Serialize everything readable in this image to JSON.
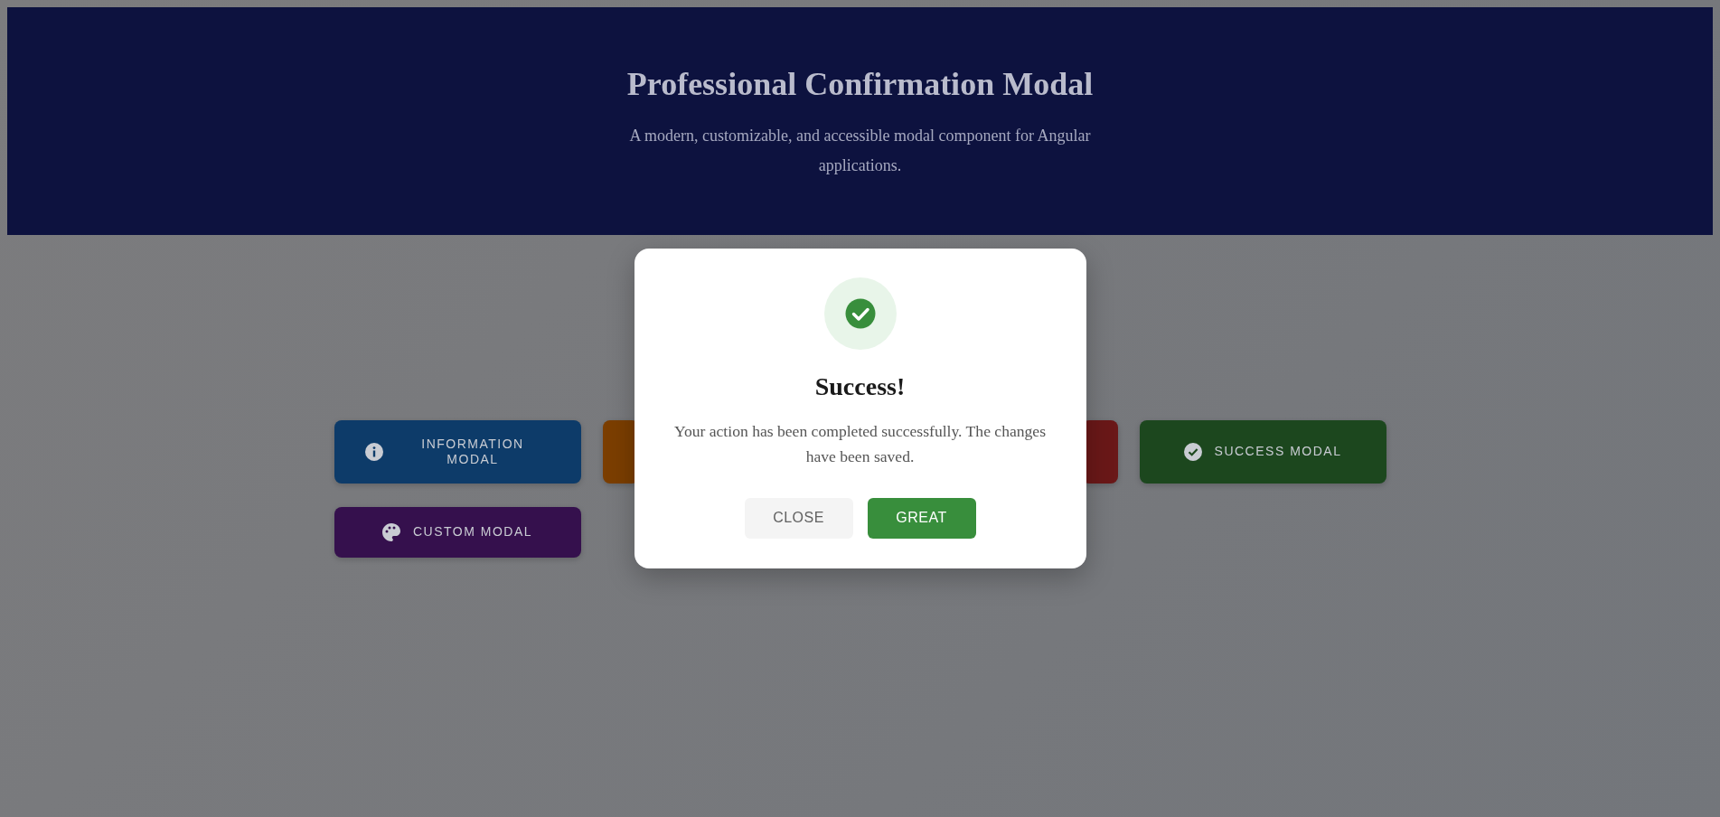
{
  "page": {
    "header": {
      "title": "Professional Confirmation Modal",
      "subtitle": "A modern, customizable, and accessible modal component for Angular applications."
    },
    "demo_buttons": [
      {
        "kind": "info",
        "label": "INFORMATION MODAL",
        "color": "#0d3b69"
      },
      {
        "kind": "plain",
        "color": "#7b3e00"
      },
      {
        "kind": "plain",
        "color": "#6a1818"
      },
      {
        "kind": "success",
        "label": "SUCCESS MODAL",
        "color": "#1c471e"
      },
      {
        "kind": "custom",
        "label": "CUSTOM MODAL",
        "color": "#35104d"
      }
    ]
  },
  "modal": {
    "kind": "success",
    "title": "Success!",
    "message": "Your action has been completed successfully. The changes have been saved.",
    "buttons": [
      {
        "kind": "secondary",
        "label": "CLOSE"
      },
      {
        "kind": "primary",
        "label": "GREAT"
      }
    ]
  }
}
